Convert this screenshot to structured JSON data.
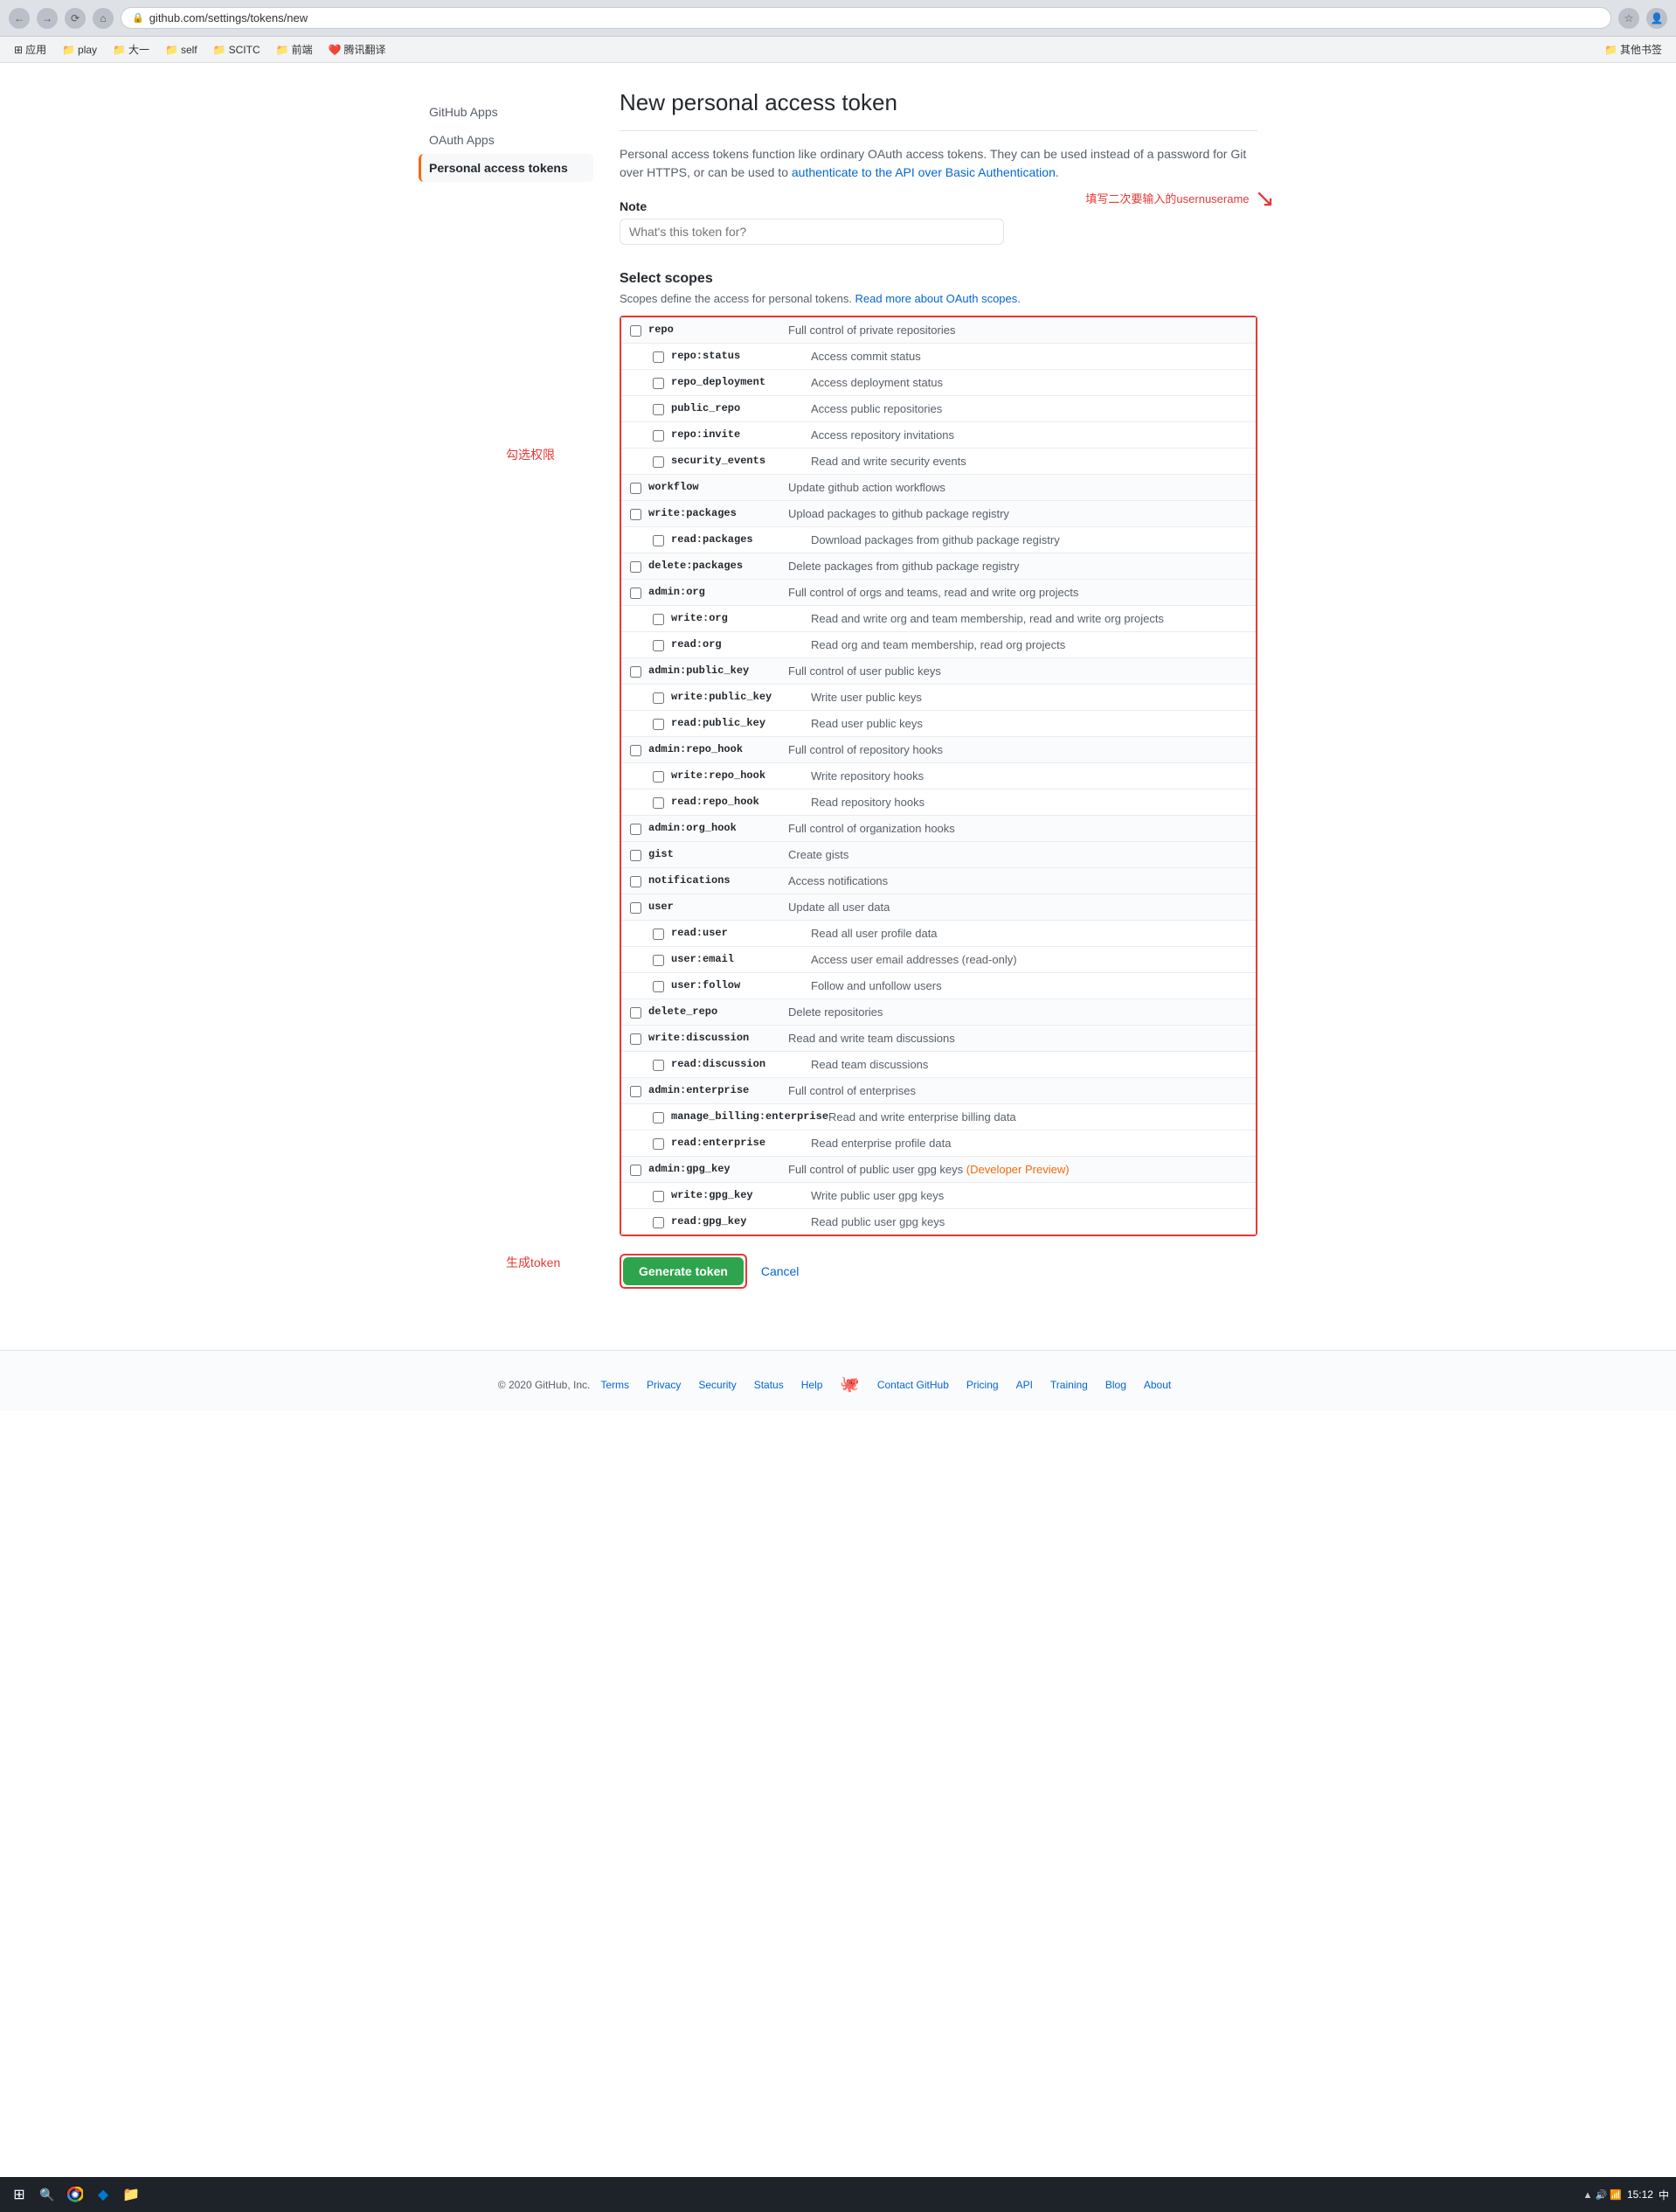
{
  "browser": {
    "url": "github.com/settings/tokens/new",
    "bookmarks": [
      {
        "label": "应用",
        "icon": "⊞"
      },
      {
        "label": "play",
        "icon": "📁"
      },
      {
        "label": "大一",
        "icon": "📁"
      },
      {
        "label": "self",
        "icon": "📁"
      },
      {
        "label": "SCITC",
        "icon": "📁"
      },
      {
        "label": "前端",
        "icon": "📁"
      },
      {
        "label": "腾讯翻译",
        "icon": "❤️"
      },
      {
        "label": "其他书签",
        "icon": "📁"
      }
    ]
  },
  "page": {
    "title": "New personal access token",
    "description_text": "Personal access tokens function like ordinary OAuth access tokens. They can be used instead of a password for Git over HTTPS, or can be used to ",
    "description_link": "authenticate to the API over Basic Authentication.",
    "description_link_url": "#"
  },
  "sidebar": {
    "items": [
      {
        "label": "GitHub Apps",
        "active": false
      },
      {
        "label": "OAuth Apps",
        "active": false
      },
      {
        "label": "Personal access tokens",
        "active": true
      }
    ]
  },
  "note_section": {
    "label": "Note",
    "placeholder": "What's this token for?"
  },
  "annotation": {
    "arrow_text": "填写二次要输入的usernuserame",
    "left_label_1": "勾选权限",
    "left_label_2": "生成token"
  },
  "scopes": {
    "title": "Select scopes",
    "description": "Scopes define the access for personal tokens. ",
    "link": "Read more about OAuth scopes.",
    "items": [
      {
        "id": "repo",
        "name": "repo",
        "desc": "Full control of private repositories",
        "level": 0,
        "checked": false
      },
      {
        "id": "repo_status",
        "name": "repo:status",
        "desc": "Access commit status",
        "level": 1,
        "checked": false
      },
      {
        "id": "repo_deployment",
        "name": "repo_deployment",
        "desc": "Access deployment status",
        "level": 1,
        "checked": false
      },
      {
        "id": "public_repo",
        "name": "public_repo",
        "desc": "Access public repositories",
        "level": 1,
        "checked": false
      },
      {
        "id": "repo_invite",
        "name": "repo:invite",
        "desc": "Access repository invitations",
        "level": 1,
        "checked": false
      },
      {
        "id": "security_events",
        "name": "security_events",
        "desc": "Read and write security events",
        "level": 1,
        "checked": false
      },
      {
        "id": "workflow",
        "name": "workflow",
        "desc": "Update github action workflows",
        "level": 0,
        "checked": false
      },
      {
        "id": "write_packages",
        "name": "write:packages",
        "desc": "Upload packages to github package registry",
        "level": 0,
        "checked": false
      },
      {
        "id": "read_packages",
        "name": "read:packages",
        "desc": "Download packages from github package registry",
        "level": 1,
        "checked": false
      },
      {
        "id": "delete_packages",
        "name": "delete:packages",
        "desc": "Delete packages from github package registry",
        "level": 0,
        "checked": false
      },
      {
        "id": "admin_org",
        "name": "admin:org",
        "desc": "Full control of orgs and teams, read and write org projects",
        "level": 0,
        "checked": false
      },
      {
        "id": "write_org",
        "name": "write:org",
        "desc": "Read and write org and team membership, read and write org projects",
        "level": 1,
        "checked": false
      },
      {
        "id": "read_org",
        "name": "read:org",
        "desc": "Read org and team membership, read org projects",
        "level": 1,
        "checked": false
      },
      {
        "id": "admin_public_key",
        "name": "admin:public_key",
        "desc": "Full control of user public keys",
        "level": 0,
        "checked": false
      },
      {
        "id": "write_public_key",
        "name": "write:public_key",
        "desc": "Write user public keys",
        "level": 1,
        "checked": false
      },
      {
        "id": "read_public_key",
        "name": "read:public_key",
        "desc": "Read user public keys",
        "level": 1,
        "checked": false
      },
      {
        "id": "admin_repo_hook",
        "name": "admin:repo_hook",
        "desc": "Full control of repository hooks",
        "level": 0,
        "checked": false
      },
      {
        "id": "write_repo_hook",
        "name": "write:repo_hook",
        "desc": "Write repository hooks",
        "level": 1,
        "checked": false
      },
      {
        "id": "read_repo_hook",
        "name": "read:repo_hook",
        "desc": "Read repository hooks",
        "level": 1,
        "checked": false
      },
      {
        "id": "admin_org_hook",
        "name": "admin:org_hook",
        "desc": "Full control of organization hooks",
        "level": 0,
        "checked": false
      },
      {
        "id": "gist",
        "name": "gist",
        "desc": "Create gists",
        "level": 0,
        "checked": false
      },
      {
        "id": "notifications",
        "name": "notifications",
        "desc": "Access notifications",
        "level": 0,
        "checked": false
      },
      {
        "id": "user",
        "name": "user",
        "desc": "Update all user data",
        "level": 0,
        "checked": false
      },
      {
        "id": "read_user",
        "name": "read:user",
        "desc": "Read all user profile data",
        "level": 1,
        "checked": false
      },
      {
        "id": "user_email",
        "name": "user:email",
        "desc": "Access user email addresses (read-only)",
        "level": 1,
        "checked": false
      },
      {
        "id": "user_follow",
        "name": "user:follow",
        "desc": "Follow and unfollow users",
        "level": 1,
        "checked": false
      },
      {
        "id": "delete_repo",
        "name": "delete_repo",
        "desc": "Delete repositories",
        "level": 0,
        "checked": false
      },
      {
        "id": "write_discussion",
        "name": "write:discussion",
        "desc": "Read and write team discussions",
        "level": 0,
        "checked": false
      },
      {
        "id": "read_discussion",
        "name": "read:discussion",
        "desc": "Read team discussions",
        "level": 1,
        "checked": false
      },
      {
        "id": "admin_enterprise",
        "name": "admin:enterprise",
        "desc": "Full control of enterprises",
        "level": 0,
        "checked": false
      },
      {
        "id": "manage_billing_enterprise",
        "name": "manage_billing:enterprise",
        "desc": "Read and write enterprise billing data",
        "level": 1,
        "checked": false
      },
      {
        "id": "read_enterprise",
        "name": "read:enterprise",
        "desc": "Read enterprise profile data",
        "level": 1,
        "checked": false
      },
      {
        "id": "admin_gpg_key",
        "name": "admin:gpg_key",
        "desc": "Full control of public user gpg keys",
        "level": 0,
        "checked": false,
        "badge": "(Developer Preview)"
      },
      {
        "id": "write_gpg_key",
        "name": "write:gpg_key",
        "desc": "Write public user gpg keys",
        "level": 1,
        "checked": false
      },
      {
        "id": "read_gpg_key",
        "name": "read:gpg_key",
        "desc": "Read public user gpg keys",
        "level": 1,
        "checked": false
      }
    ]
  },
  "actions": {
    "generate_label": "Generate token",
    "cancel_label": "Cancel"
  },
  "footer": {
    "copyright": "© 2020 GitHub, Inc.",
    "links": [
      "Terms",
      "Privacy",
      "Security",
      "Status",
      "Help",
      "Contact GitHub",
      "Pricing",
      "API",
      "Training",
      "Blog",
      "About"
    ]
  },
  "taskbar": {
    "time": "15:12",
    "date": "中"
  }
}
